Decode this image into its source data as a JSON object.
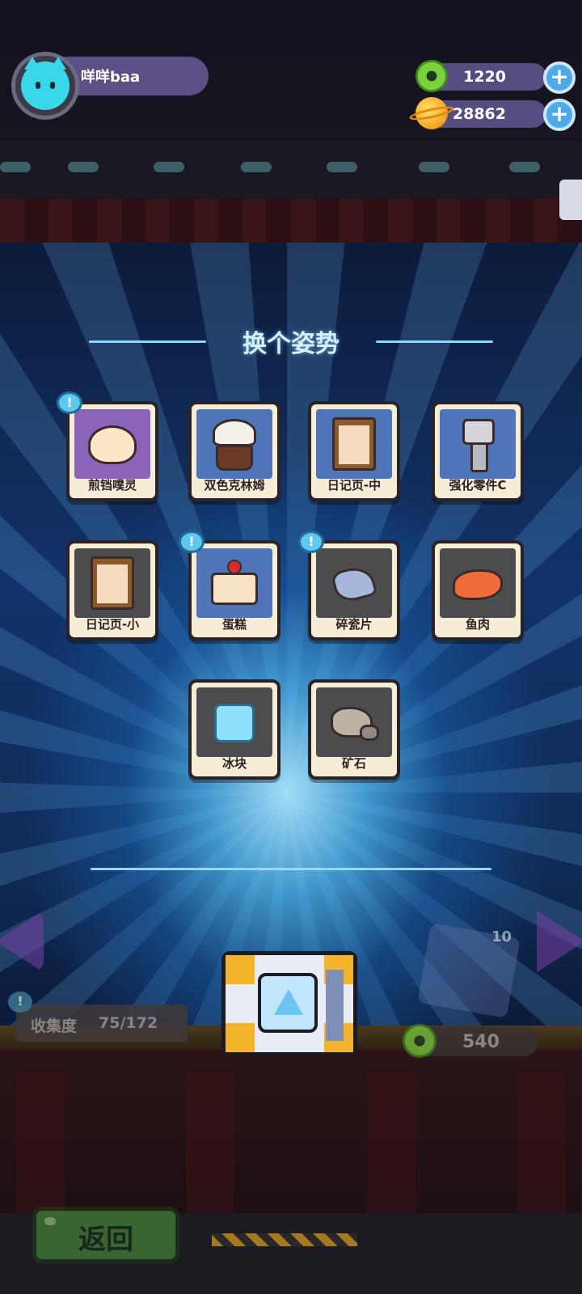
{
  "header": {
    "player_name": "咩咩baa",
    "currencies": [
      {
        "icon": "donut-coin-icon",
        "value": "1220"
      },
      {
        "icon": "planet-coin-icon",
        "value": "28862"
      }
    ],
    "add_label": "+"
  },
  "panel": {
    "title": "换个姿势",
    "new_badge": "!",
    "items": [
      {
        "label": "煎铛噗灵",
        "icon": "dumpling-icon",
        "new": true
      },
      {
        "label": "双色克林姆",
        "icon": "cupcake-icon",
        "new": false
      },
      {
        "label": "日记页-中",
        "icon": "diary-frame-icon",
        "new": false
      },
      {
        "label": "强化零件C",
        "icon": "bolt-icon",
        "new": false
      },
      {
        "label": "日记页-小",
        "icon": "diary-frame-icon",
        "new": false
      },
      {
        "label": "蛋糕",
        "icon": "cake-icon",
        "new": true
      },
      {
        "label": "碎瓷片",
        "icon": "porcelain-shard-icon",
        "new": true
      },
      {
        "label": "鱼肉",
        "icon": "fish-meat-icon",
        "new": false
      },
      {
        "label": "冰块",
        "icon": "ice-cube-icon",
        "new": false
      },
      {
        "label": "矿石",
        "icon": "ore-icon",
        "new": false
      }
    ]
  },
  "collection": {
    "label": "收集度",
    "value": "75/172",
    "badge": "!"
  },
  "gacha": {
    "remaining": "10",
    "cost": "540"
  },
  "back_button": {
    "label": "返回"
  },
  "colors": {
    "accent_blue": "#4da9e8",
    "card_bg": "#f5edd6",
    "currency_bar": "#574c80",
    "back_green": "#4fa23c"
  }
}
